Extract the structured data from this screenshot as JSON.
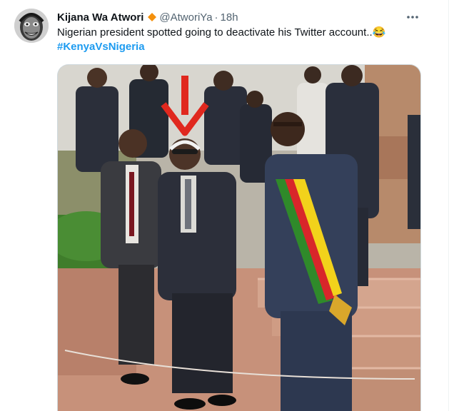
{
  "tweet": {
    "author_name": "Kijana Wa Atwori",
    "handle": "@AtworiYa",
    "separator": "·",
    "time": "18h",
    "text": "Nigerian president spotted going to deactivate his Twitter account..😂",
    "hashtag": "#KenyaVsNigeria"
  },
  "colors": {
    "accent": "#1d9bf0",
    "verified_badge": "#f4900c",
    "secondary_text": "#536471",
    "arrow": "#e0281e"
  },
  "icons": {
    "verified": "verified-badge-icon",
    "more": "more-options-icon"
  }
}
